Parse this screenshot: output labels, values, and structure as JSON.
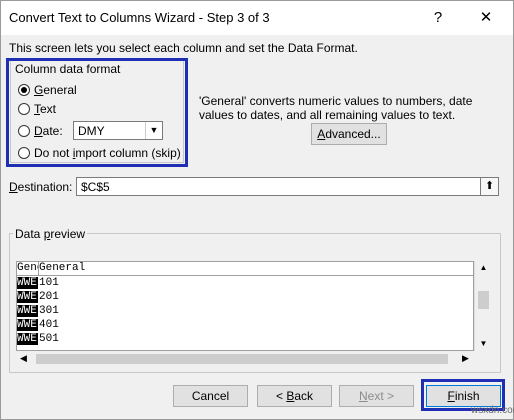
{
  "window": {
    "title": "Convert Text to Columns Wizard - Step 3 of 3",
    "help": "?",
    "close": "✕"
  },
  "description": "This screen lets you select each column and set the Data Format.",
  "format_group": {
    "label": "Column data format",
    "options": [
      {
        "prefix": "",
        "hot": "G",
        "rest": "eneral",
        "selected": true
      },
      {
        "prefix": "",
        "hot": "T",
        "rest": "ext",
        "selected": false
      },
      {
        "prefix": "",
        "hot": "D",
        "rest": "ate:",
        "selected": false
      },
      {
        "prefix": "Do not ",
        "hot": "i",
        "rest": "mport column (skip)",
        "selected": false
      }
    ],
    "date_value": "DMY"
  },
  "info_text": "'General' converts numeric values to numbers, date values to dates, and all remaining values to text.",
  "advanced_button": {
    "hot": "A",
    "rest": "dvanced..."
  },
  "destination": {
    "label_hot": "D",
    "label_rest": "estination:",
    "value": "$C$5",
    "collapse_icon": "⬆"
  },
  "preview": {
    "label_pre": "Data ",
    "label_hot": "p",
    "label_rest": "review",
    "headers": [
      "General",
      "General"
    ],
    "rows": [
      [
        "WWE",
        "101"
      ],
      [
        "WWE",
        "201"
      ],
      [
        "WWE",
        "301"
      ],
      [
        "WWE",
        "401"
      ],
      [
        "WWE",
        "501"
      ]
    ]
  },
  "buttons": {
    "cancel": "Cancel",
    "back_pre": "< ",
    "back_hot": "B",
    "back_rest": "ack",
    "next_pre": "",
    "next_hot": "N",
    "next_rest": "ext >",
    "finish_hot": "F",
    "finish_rest": "inish"
  },
  "watermark": "wsxdn.com"
}
